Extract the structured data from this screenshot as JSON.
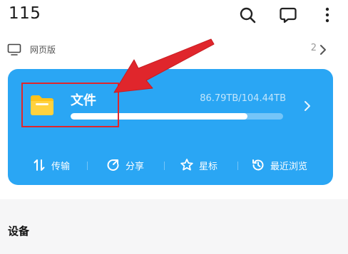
{
  "header": {
    "title": "115",
    "icons": [
      "search-icon",
      "message-icon",
      "more-icon"
    ]
  },
  "web_row": {
    "label": "网页版",
    "count": "2",
    "icon": "monitor-icon"
  },
  "card": {
    "title": "文件",
    "storage": "86.79TB/104.44TB",
    "usage_fraction": 0.831,
    "bg_color": "#2aa6f4",
    "folder_color": "#ffc21a",
    "actions": [
      {
        "label": "传输",
        "icon": "transfer-icon"
      },
      {
        "label": "分享",
        "icon": "share-icon"
      },
      {
        "label": "星标",
        "icon": "star-icon"
      },
      {
        "label": "最近浏览",
        "icon": "recent-icon"
      }
    ]
  },
  "annotation": {
    "color": "#e0262c"
  },
  "section": {
    "title": "设备"
  }
}
